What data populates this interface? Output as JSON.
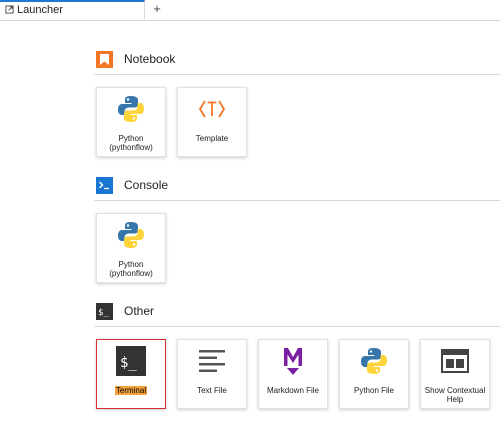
{
  "tabs": [
    {
      "label": "Launcher",
      "icon": "launcher-icon"
    }
  ],
  "add_tab_label": "+",
  "sections": {
    "notebook": {
      "title": "Notebook",
      "icon": "notebook-icon",
      "color": "#f37626",
      "items": [
        {
          "label": "Python (pythonflow)",
          "icon": "python-icon"
        },
        {
          "label": "Template",
          "icon": "template-icon"
        }
      ]
    },
    "console": {
      "title": "Console",
      "icon": "console-icon",
      "color": "#1976d2",
      "items": [
        {
          "label": "Python (pythonflow)",
          "icon": "python-icon"
        }
      ]
    },
    "other": {
      "title": "Other",
      "icon": "other-icon",
      "color": "#333333",
      "items": [
        {
          "label": "Terminal",
          "icon": "terminal-icon"
        },
        {
          "label": "Text File",
          "icon": "text-file-icon"
        },
        {
          "label": "Markdown File",
          "icon": "markdown-icon"
        },
        {
          "label": "Python File",
          "icon": "python-icon"
        },
        {
          "label": "Show Contextual Help",
          "icon": "contextual-help-icon"
        }
      ]
    }
  }
}
